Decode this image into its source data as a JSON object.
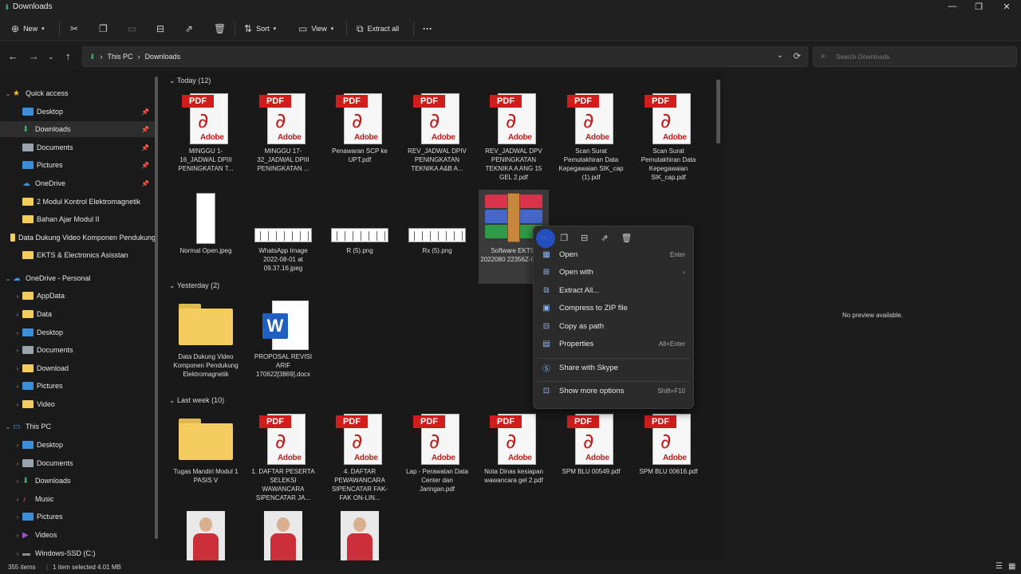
{
  "window": {
    "title": "Downloads",
    "controls": [
      "—",
      "❐",
      "✕"
    ]
  },
  "toolbar": {
    "new_label": "New",
    "sort_label": "Sort",
    "view_label": "View",
    "extract_label": "Extract all",
    "more_label": "···"
  },
  "address": {
    "crumbs": [
      "This PC",
      "›",
      "Downloads"
    ],
    "separator": "›",
    "search_placeholder": "Search Downloads"
  },
  "sidebar": {
    "items": [
      {
        "label": "Quick access",
        "icon": "star",
        "color": "#f2c430"
      },
      {
        "label": "Desktop",
        "icon": "folder",
        "color": "#3a8fd8",
        "pinned": true
      },
      {
        "label": "Downloads",
        "icon": "download",
        "color": "#3cb371",
        "pinned": true,
        "selected": true
      },
      {
        "label": "Documents",
        "icon": "document",
        "color": "#9aa4ad",
        "pinned": true
      },
      {
        "label": "Pictures",
        "icon": "picture",
        "color": "#3a8fd8",
        "pinned": true
      },
      {
        "label": "OneDrive",
        "icon": "cloud",
        "color": "#3a8fd8",
        "pinned": true
      },
      {
        "label": "2 Modul Kontrol Elektromagnetik",
        "icon": "folder",
        "color": "#f3cd5d"
      },
      {
        "label": "Bahan Ajar Modul II",
        "icon": "folder",
        "color": "#f3cd5d"
      },
      {
        "label": "Data Dukung Video Komponen Pendukung",
        "icon": "folder",
        "color": "#f3cd5d"
      },
      {
        "label": "EKTS & Electronics Asisstan",
        "icon": "folder",
        "color": "#f3cd5d"
      },
      {
        "label": "OneDrive - Personal",
        "icon": "cloud",
        "color": "#3a8fd8"
      },
      {
        "label": "AppData",
        "icon": "folder",
        "color": "#f3cd5d"
      },
      {
        "label": "Data",
        "icon": "folder",
        "color": "#f3cd5d"
      },
      {
        "label": "Desktop",
        "icon": "folder",
        "color": "#3a8fd8"
      },
      {
        "label": "Documents",
        "icon": "document",
        "color": "#9aa4ad"
      },
      {
        "label": "Download",
        "icon": "folder",
        "color": "#f3cd5d"
      },
      {
        "label": "Pictures",
        "icon": "picture",
        "color": "#3a8fd8"
      },
      {
        "label": "Video",
        "icon": "folder",
        "color": "#f3cd5d"
      },
      {
        "label": "This PC",
        "icon": "pc",
        "color": "#4a9de0"
      },
      {
        "label": "Desktop",
        "icon": "folder",
        "color": "#3a8fd8"
      },
      {
        "label": "Documents",
        "icon": "document",
        "color": "#9aa4ad"
      },
      {
        "label": "Downloads",
        "icon": "download",
        "color": "#3cb371"
      },
      {
        "label": "Music",
        "icon": "music",
        "color": "#e05555"
      },
      {
        "label": "Pictures",
        "icon": "picture",
        "color": "#3a8fd8"
      },
      {
        "label": "Videos",
        "icon": "video",
        "color": "#9b59d0"
      },
      {
        "label": "Windows-SSD (C:)",
        "icon": "drive",
        "color": "#8a8a8a"
      }
    ]
  },
  "groups": {
    "today": "Today (12)",
    "yesterday": "Yesterday (2)",
    "lastweek": "Last week (10)"
  },
  "files": {
    "today": [
      {
        "name": "MINGGU 1-16_JADWAL DPIII PENINGKATAN T...",
        "type": "pdf"
      },
      {
        "name": "MINGGU 17-32_JADWAL DPIII PENINGKATAN ...",
        "type": "pdf"
      },
      {
        "name": "Penawaran SCP ke UPT.pdf",
        "type": "pdf"
      },
      {
        "name": "REV_JADWAL DPIV PENINGKATAN TEKNIKA A&B A...",
        "type": "pdf"
      },
      {
        "name": "REV_JADWAL DPV PENINGKATAN TEKNIKA A ANG 15 GEL 2.pdf",
        "type": "pdf"
      },
      {
        "name": "Scan Surat Pemutakhiran Data Kepegawaian SIK_cap (1).pdf",
        "type": "pdf"
      },
      {
        "name": "Scan Surat Pemutakhiran Data Kepegawaian SIK_cap.pdf",
        "type": "pdf"
      },
      {
        "name": "Normal Open.jpeg",
        "type": "image-tall"
      },
      {
        "name": "WhatsApp Image 2022-08-01 at 09.37.16.jpeg",
        "type": "strip"
      },
      {
        "name": "R (5).png",
        "type": "strip"
      },
      {
        "name": "Rx (5).png",
        "type": "strip"
      },
      {
        "name": "Software EKTS-2022080 22356Z-001...",
        "type": "archive",
        "selected": true
      }
    ],
    "yesterday": [
      {
        "name": "Data Dukung Video Komponen Pendukung Elektromagnetik",
        "type": "folder"
      },
      {
        "name": "PROPOSAL REVISI ARIF 170622[3869].docx",
        "type": "word"
      }
    ],
    "lastweek": [
      {
        "name": "Tugas Mandiri Modul 1 PASIS V",
        "type": "folder"
      },
      {
        "name": "1. DAFTAR PESERTA SELEKSI WAWANCARA SIPENCATAR JA...",
        "type": "pdf"
      },
      {
        "name": "4. DAFTAR PEWAWANCARA SIPENCATAR FAK-FAK ON-LIN...",
        "type": "pdf"
      },
      {
        "name": "Lap - Perawatan Data Center dan Jaringan.pdf",
        "type": "pdf"
      },
      {
        "name": "Nota Dinas kesiapan wawancara gel 2.pdf",
        "type": "pdf"
      },
      {
        "name": "SPM BLU 00549.pdf",
        "type": "pdf"
      },
      {
        "name": "SPM BLU 00616.pdf",
        "type": "pdf"
      },
      {
        "name": "",
        "type": "photo"
      },
      {
        "name": "",
        "type": "photo"
      },
      {
        "name": "",
        "type": "photo"
      }
    ]
  },
  "icon_text": {
    "pdf_tag": "PDF",
    "adobe": "Adobe",
    "word": "W"
  },
  "context_menu": {
    "items": [
      {
        "label": "Open",
        "shortcut": "Enter",
        "icon": "archive-icon"
      },
      {
        "label": "Open with",
        "shortcut": "›",
        "icon": "open-with-icon"
      },
      {
        "label": "Extract All...",
        "shortcut": "",
        "icon": "extract-icon"
      },
      {
        "label": "Compress to ZIP file",
        "shortcut": "",
        "icon": "zip-icon"
      },
      {
        "label": "Copy as path",
        "shortcut": "",
        "icon": "path-icon"
      },
      {
        "label": "Properties",
        "shortcut": "Alt+Enter",
        "icon": "properties-icon"
      },
      {
        "label": "Share with Skype",
        "shortcut": "",
        "icon": "skype-icon"
      },
      {
        "label": "Show more options",
        "shortcut": "Shift+F10",
        "icon": "more-options-icon"
      }
    ]
  },
  "preview": {
    "message": "No preview available."
  },
  "status": {
    "items": "355 items",
    "selected": "1 item selected  4.01 MB"
  }
}
